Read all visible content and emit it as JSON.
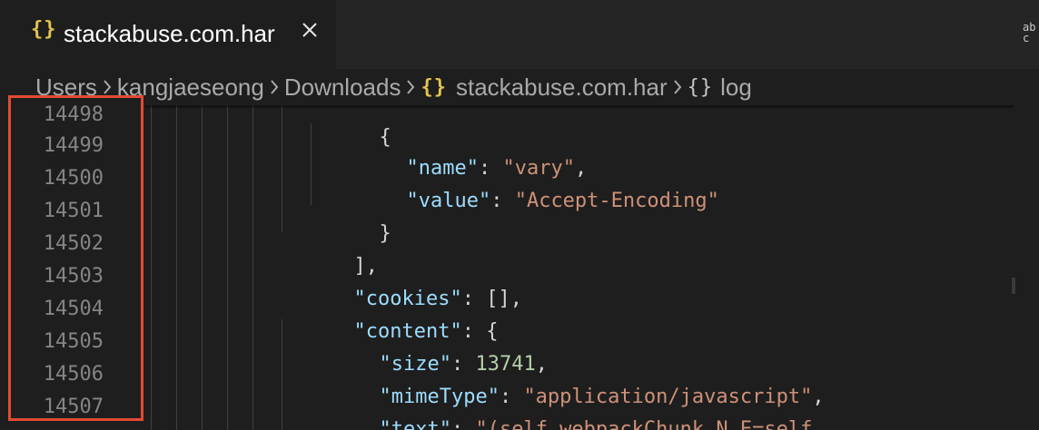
{
  "tab": {
    "icon_glyph": "{}",
    "title": "stackabuse.com.har",
    "close_glyph": "×"
  },
  "breadcrumb": {
    "items": [
      "Users",
      "kangjaeseong",
      "Downloads",
      "stackabuse.com.har",
      "log"
    ],
    "separator": "›",
    "file_icon_glyph": "{}",
    "log_icon_glyph": "{}"
  },
  "editor": {
    "lines": [
      {
        "no": "14498",
        "text": "{"
      },
      {
        "no": "14499",
        "key": "\"name\"",
        "colon": ": ",
        "value": "\"vary\"",
        "tail": ","
      },
      {
        "no": "14500",
        "key": "\"value\"",
        "colon": ": ",
        "value": "\"Accept-Encoding\"",
        "tail": ""
      },
      {
        "no": "14501",
        "text": "}"
      },
      {
        "no": "14502",
        "text": "],"
      },
      {
        "no": "14503",
        "key": "\"cookies\"",
        "colon": ": ",
        "value": "[]",
        "tail": ","
      },
      {
        "no": "14504",
        "key": "\"content\"",
        "colon": ": ",
        "value": "{",
        "tail": ""
      },
      {
        "no": "14505",
        "key": "\"size\"",
        "colon": ": ",
        "value": "13741",
        "tail": ","
      },
      {
        "no": "14506",
        "key": "\"mimeType\"",
        "colon": ": ",
        "value": "\"application/javascript\"",
        "tail": ","
      },
      {
        "no": "14507",
        "key": "\"text\"",
        "colon": ": ",
        "value": "\"(self.webpackChunk_N_E=self.",
        "tail": ""
      }
    ]
  },
  "colors": {
    "key": "#9cdcfe",
    "string": "#ce9178",
    "number": "#b5cea8",
    "highlight": "#e34a33"
  },
  "right_action": {
    "label_top": "ab",
    "label_bottom": "c",
    "arrow_glyph": "⇔"
  }
}
